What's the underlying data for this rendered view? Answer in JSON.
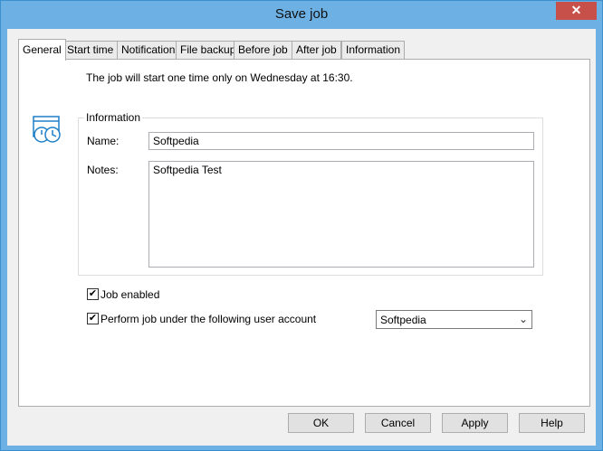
{
  "window": {
    "title": "Save job",
    "close_glyph": "✕"
  },
  "tabs": [
    {
      "label": "General",
      "active": true
    },
    {
      "label": "Start time"
    },
    {
      "label": "Notification"
    },
    {
      "label": "File backup"
    },
    {
      "label": "Before job"
    },
    {
      "label": "After job"
    },
    {
      "label": "Information"
    }
  ],
  "general": {
    "summary": "The job will start one time only on Wednesday at 16:30.",
    "icon": "calendar-clock-icon",
    "information_group": "Information",
    "name_label": "Name:",
    "name_value": "Softpedia",
    "notes_label": "Notes:",
    "notes_value": "Softpedia Test",
    "job_enabled_label": "Job enabled",
    "job_enabled_checked": true,
    "perform_as_user_label": "Perform job under the following user account",
    "perform_as_user_checked": true,
    "user_account": "Softpedia"
  },
  "buttons": {
    "ok": "OK",
    "cancel": "Cancel",
    "apply": "Apply",
    "help": "Help"
  },
  "colors": {
    "titlebar": "#6cb0e4",
    "close": "#c7504a",
    "dialog": "#f0f0f0"
  }
}
